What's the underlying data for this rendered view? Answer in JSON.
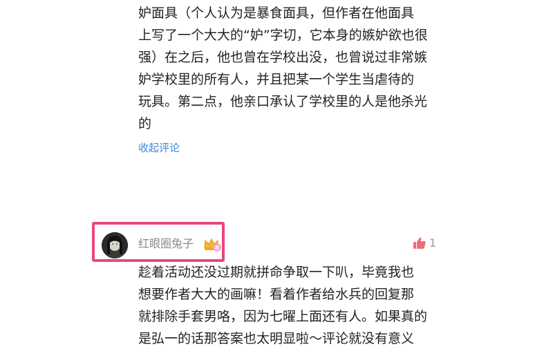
{
  "previous_comment": {
    "lines": [
      "妒面具（个人认为是暴食面具，但作者在他面具",
      "上写了一个大大的“妒”字切，它本身的嫉妒欲也很",
      "强）在之后，他也曾在学校出没，也曾说过非常嫉",
      "妒学校里的所有人，并且把某一个学生当虐待的",
      "玩具。第二点，他亲口承认了学校里的人是他杀光",
      "的"
    ],
    "collapse_label": "收起评论"
  },
  "comment": {
    "username": "红眼圈兔子",
    "level": "8",
    "like_count": "1",
    "lines": [
      "趁着活动还没过期就拼命争取一下叭，毕竟我也",
      "想要作者大大的画嘛！看着作者给水兵的回复那",
      "就排除手套男咯，因为七曜上面还有人。如果真的",
      "是弘一的话那答案也太明显啦～评论就没有意义"
    ],
    "icons": {
      "avatar": "user-avatar",
      "badge": "crown-level-badge-icon",
      "like": "thumbs-up-icon"
    }
  },
  "colors": {
    "link": "#3d88d6",
    "highlight": "#e8467c",
    "like_icon": "#f06a7a",
    "badge": "#f7b733"
  }
}
